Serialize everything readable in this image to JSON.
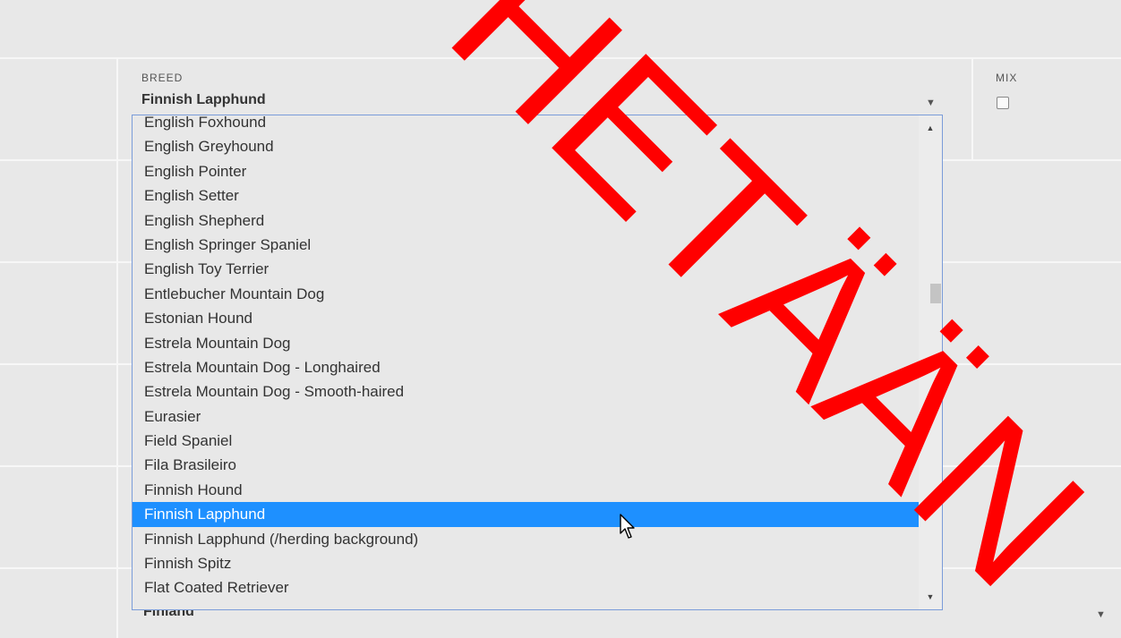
{
  "breed_field": {
    "label": "BREED",
    "value": "Finnish Lapphund",
    "options": [
      "English Foxhound",
      "English Greyhound",
      "English Pointer",
      "English Setter",
      "English Shepherd",
      "English Springer Spaniel",
      "English Toy Terrier",
      "Entlebucher Mountain Dog",
      "Estonian Hound",
      "Estrela Mountain Dog",
      "Estrela Mountain Dog - Longhaired",
      "Estrela Mountain Dog - Smooth-haired",
      "Eurasier",
      "Field Spaniel",
      "Fila Brasileiro",
      "Finnish Hound",
      "Finnish Lapphund",
      "Finnish Lapphund (/herding background)",
      "Finnish Spitz",
      "Flat Coated Retriever"
    ],
    "selected_index": 16
  },
  "mix_field": {
    "label": "MIX",
    "checked": false
  },
  "country_field": {
    "value": "Finland"
  },
  "watermark": {
    "text": "HETÄÄN",
    "color": "#ff0000"
  },
  "colors": {
    "highlight": "#1e90ff",
    "background": "#e8e8e8",
    "focus_border": "#7a9cd9"
  }
}
